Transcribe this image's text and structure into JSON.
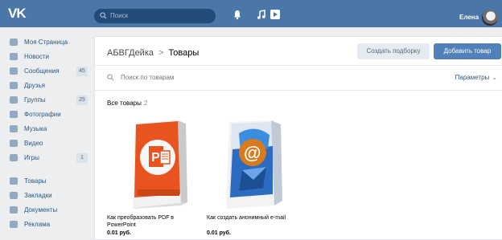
{
  "header": {
    "logo": "VK",
    "search_placeholder": "Поиск",
    "user_name": "Елена"
  },
  "sidebar": {
    "items": [
      {
        "label": "Моя Страница",
        "icon": "home-icon"
      },
      {
        "label": "Новости",
        "icon": "news-icon"
      },
      {
        "label": "Сообщения",
        "icon": "messages-icon",
        "badge": "45"
      },
      {
        "label": "Друзья",
        "icon": "friends-icon"
      },
      {
        "label": "Группы",
        "icon": "groups-icon",
        "badge": "25"
      },
      {
        "label": "Фотографии",
        "icon": "photos-icon"
      },
      {
        "label": "Музыка",
        "icon": "music-icon"
      },
      {
        "label": "Видео",
        "icon": "video-icon"
      },
      {
        "label": "Игры",
        "icon": "games-icon",
        "badge": "1"
      },
      {
        "label": "Товары",
        "icon": "goods-icon"
      },
      {
        "label": "Закладки",
        "icon": "bookmarks-icon"
      },
      {
        "label": "Документы",
        "icon": "documents-icon"
      },
      {
        "label": "Реклама",
        "icon": "ads-icon"
      }
    ]
  },
  "main": {
    "breadcrumb": {
      "group": "АБВГДейка",
      "separator": ">",
      "current": "Товары"
    },
    "create_collection_label": "Создать подборку",
    "add_product_label": "Добавить товар",
    "search_placeholder": "Поиск по товарам",
    "params_label": "Параметры",
    "all_products_label": "Все товары",
    "all_products_count": "2",
    "products": [
      {
        "name": "Как преобразовать PDF в PowerPoint",
        "price": "0.01 руб."
      },
      {
        "name": "Как создать анонимный e-mail",
        "price": "0.01 руб."
      }
    ]
  },
  "colors": {
    "header_bg": "#4a76a8",
    "link": "#2a5885",
    "primary_button": "#5181b8",
    "powerpoint_orange": "#e8541f"
  }
}
